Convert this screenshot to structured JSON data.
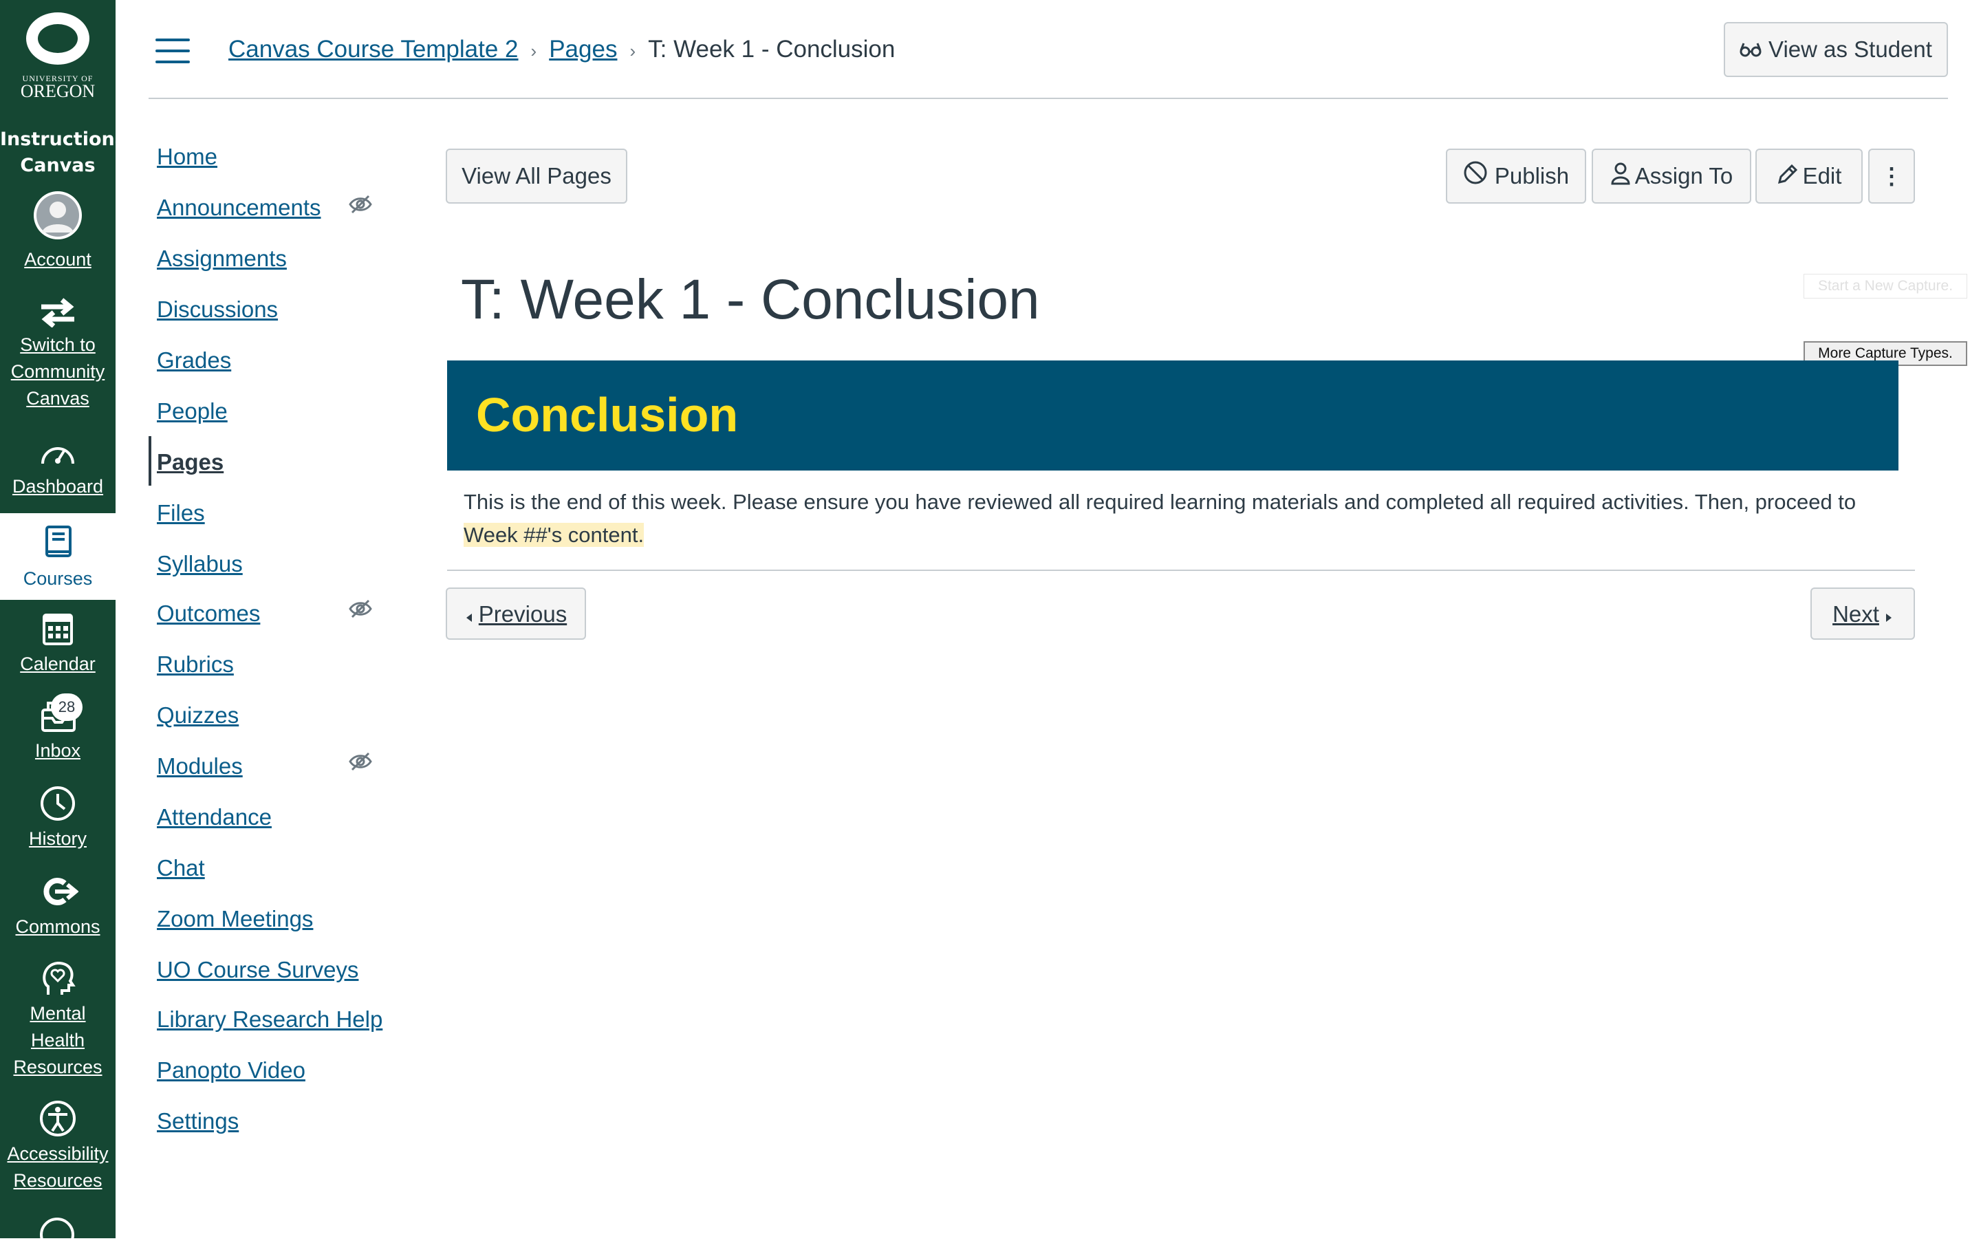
{
  "global_nav": {
    "logo_university": "UNIVERSITY OF",
    "logo_oregon": "OREGON",
    "brand": [
      "Instructional",
      "Canvas"
    ],
    "items": [
      {
        "label": "Account",
        "icon": "avatar-icon"
      },
      {
        "label": "Switch to Community Canvas",
        "icon": "switch-arrows-icon"
      },
      {
        "label": "Dashboard",
        "icon": "dashboard-gauge-icon"
      },
      {
        "label": "Courses",
        "icon": "book-icon",
        "active": true
      },
      {
        "label": "Calendar",
        "icon": "calendar-icon"
      },
      {
        "label": "Inbox",
        "icon": "inbox-icon",
        "badge": "28"
      },
      {
        "label": "History",
        "icon": "clock-icon"
      },
      {
        "label": "Commons",
        "icon": "commons-icon"
      },
      {
        "label": "Mental Health Resources",
        "icon": "heart-head-icon"
      },
      {
        "label": "Accessibility Resources",
        "icon": "accessibility-icon"
      },
      {
        "label": "",
        "icon": "help-icon"
      }
    ]
  },
  "header": {
    "breadcrumbs": [
      "Canvas Course Template 2",
      "Pages",
      "T: Week 1 - Conclusion"
    ],
    "view_as_student": "View as Student"
  },
  "course_nav": {
    "items": [
      {
        "label": "Home"
      },
      {
        "label": "Announcements",
        "hidden": true
      },
      {
        "label": "Assignments"
      },
      {
        "label": "Discussions"
      },
      {
        "label": "Grades"
      },
      {
        "label": "People"
      },
      {
        "label": "Pages",
        "active": true
      },
      {
        "label": "Files"
      },
      {
        "label": "Syllabus"
      },
      {
        "label": "Outcomes",
        "hidden": true
      },
      {
        "label": "Rubrics"
      },
      {
        "label": "Quizzes"
      },
      {
        "label": "Modules",
        "hidden": true
      },
      {
        "label": "Attendance"
      },
      {
        "label": "Chat"
      },
      {
        "label": "Zoom Meetings"
      },
      {
        "label": "UO Course Surveys"
      },
      {
        "label": "Library Research Help"
      },
      {
        "label": "Panopto Video"
      },
      {
        "label": "Settings"
      }
    ]
  },
  "toolbar": {
    "view_all_pages": "View All Pages",
    "publish": "Publish",
    "assign_to": "Assign To",
    "edit": "Edit",
    "more": "⋮"
  },
  "page": {
    "title": "T: Week 1 - Conclusion",
    "banner_heading": "Conclusion",
    "body_text": "This is the end of this week. Please ensure you have reviewed all required learning materials and completed all required activities. Then, proceed to",
    "body_highlight": "Week ##'s content."
  },
  "pagination": {
    "previous": "Previous",
    "next": "Next"
  },
  "capture_overlay": {
    "start": "Start a New Capture.",
    "more": "More Capture Types."
  },
  "colors": {
    "nav_green": "#154733",
    "link_blue": "#0b5d8a",
    "banner_blue": "#005172",
    "banner_yellow": "#fee123",
    "highlight": "#fdf0c2"
  }
}
